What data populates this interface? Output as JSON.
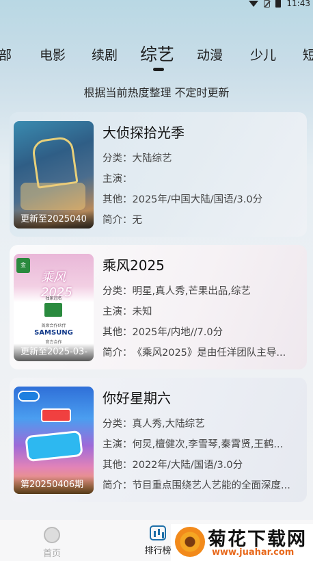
{
  "status_bar": {
    "time": "11:43"
  },
  "tabs": [
    {
      "label": "部"
    },
    {
      "label": "电影"
    },
    {
      "label": "续剧"
    },
    {
      "label": "综艺"
    },
    {
      "label": "动漫"
    },
    {
      "label": "少儿"
    },
    {
      "label": "短"
    }
  ],
  "subtitle": "根据当前热度整理 不定时更新",
  "field_labels": {
    "category": "分类：",
    "cast": "主演：",
    "other": "其他：",
    "intro": "简介："
  },
  "items": [
    {
      "title": "大侦探拾光季",
      "poster_label": "更新至2025040",
      "category": "大陆综艺",
      "cast": "",
      "other": "2025年/中国大陆/国语/3.0分",
      "intro": "无"
    },
    {
      "title": "乘风2025",
      "poster_label": "更新至2025-03-",
      "poster_text": {
        "script": "乘风2025",
        "sponsor": "SAMSUNG",
        "small1": "独家冠名",
        "small2": "首席合作伙伴",
        "small3": "官方合作"
      },
      "category": "明星,真人秀,芒果出品,综艺",
      "cast": "未知",
      "other": "2025年/内地//7.0分",
      "intro": "《乘风2025》是由任洋团队主导..."
    },
    {
      "title": "你好星期六",
      "poster_label": "第20250406期",
      "category": "真人秀,大陆综艺",
      "cast": "何炅,檀健次,李雪琴,秦霄贤,王鹤...",
      "other": "2022年/大陆/国语/3.0分",
      "intro": "节目重点围绕艺人艺能的全面深度..."
    }
  ],
  "bottom_nav": {
    "home": "首页",
    "rank": "排行榜"
  },
  "watermark": {
    "title": "菊花下载网",
    "url": "www.juahar.com"
  },
  "colors": {
    "accent": "#1e6fa8",
    "watermark_url": "#e8691c"
  }
}
